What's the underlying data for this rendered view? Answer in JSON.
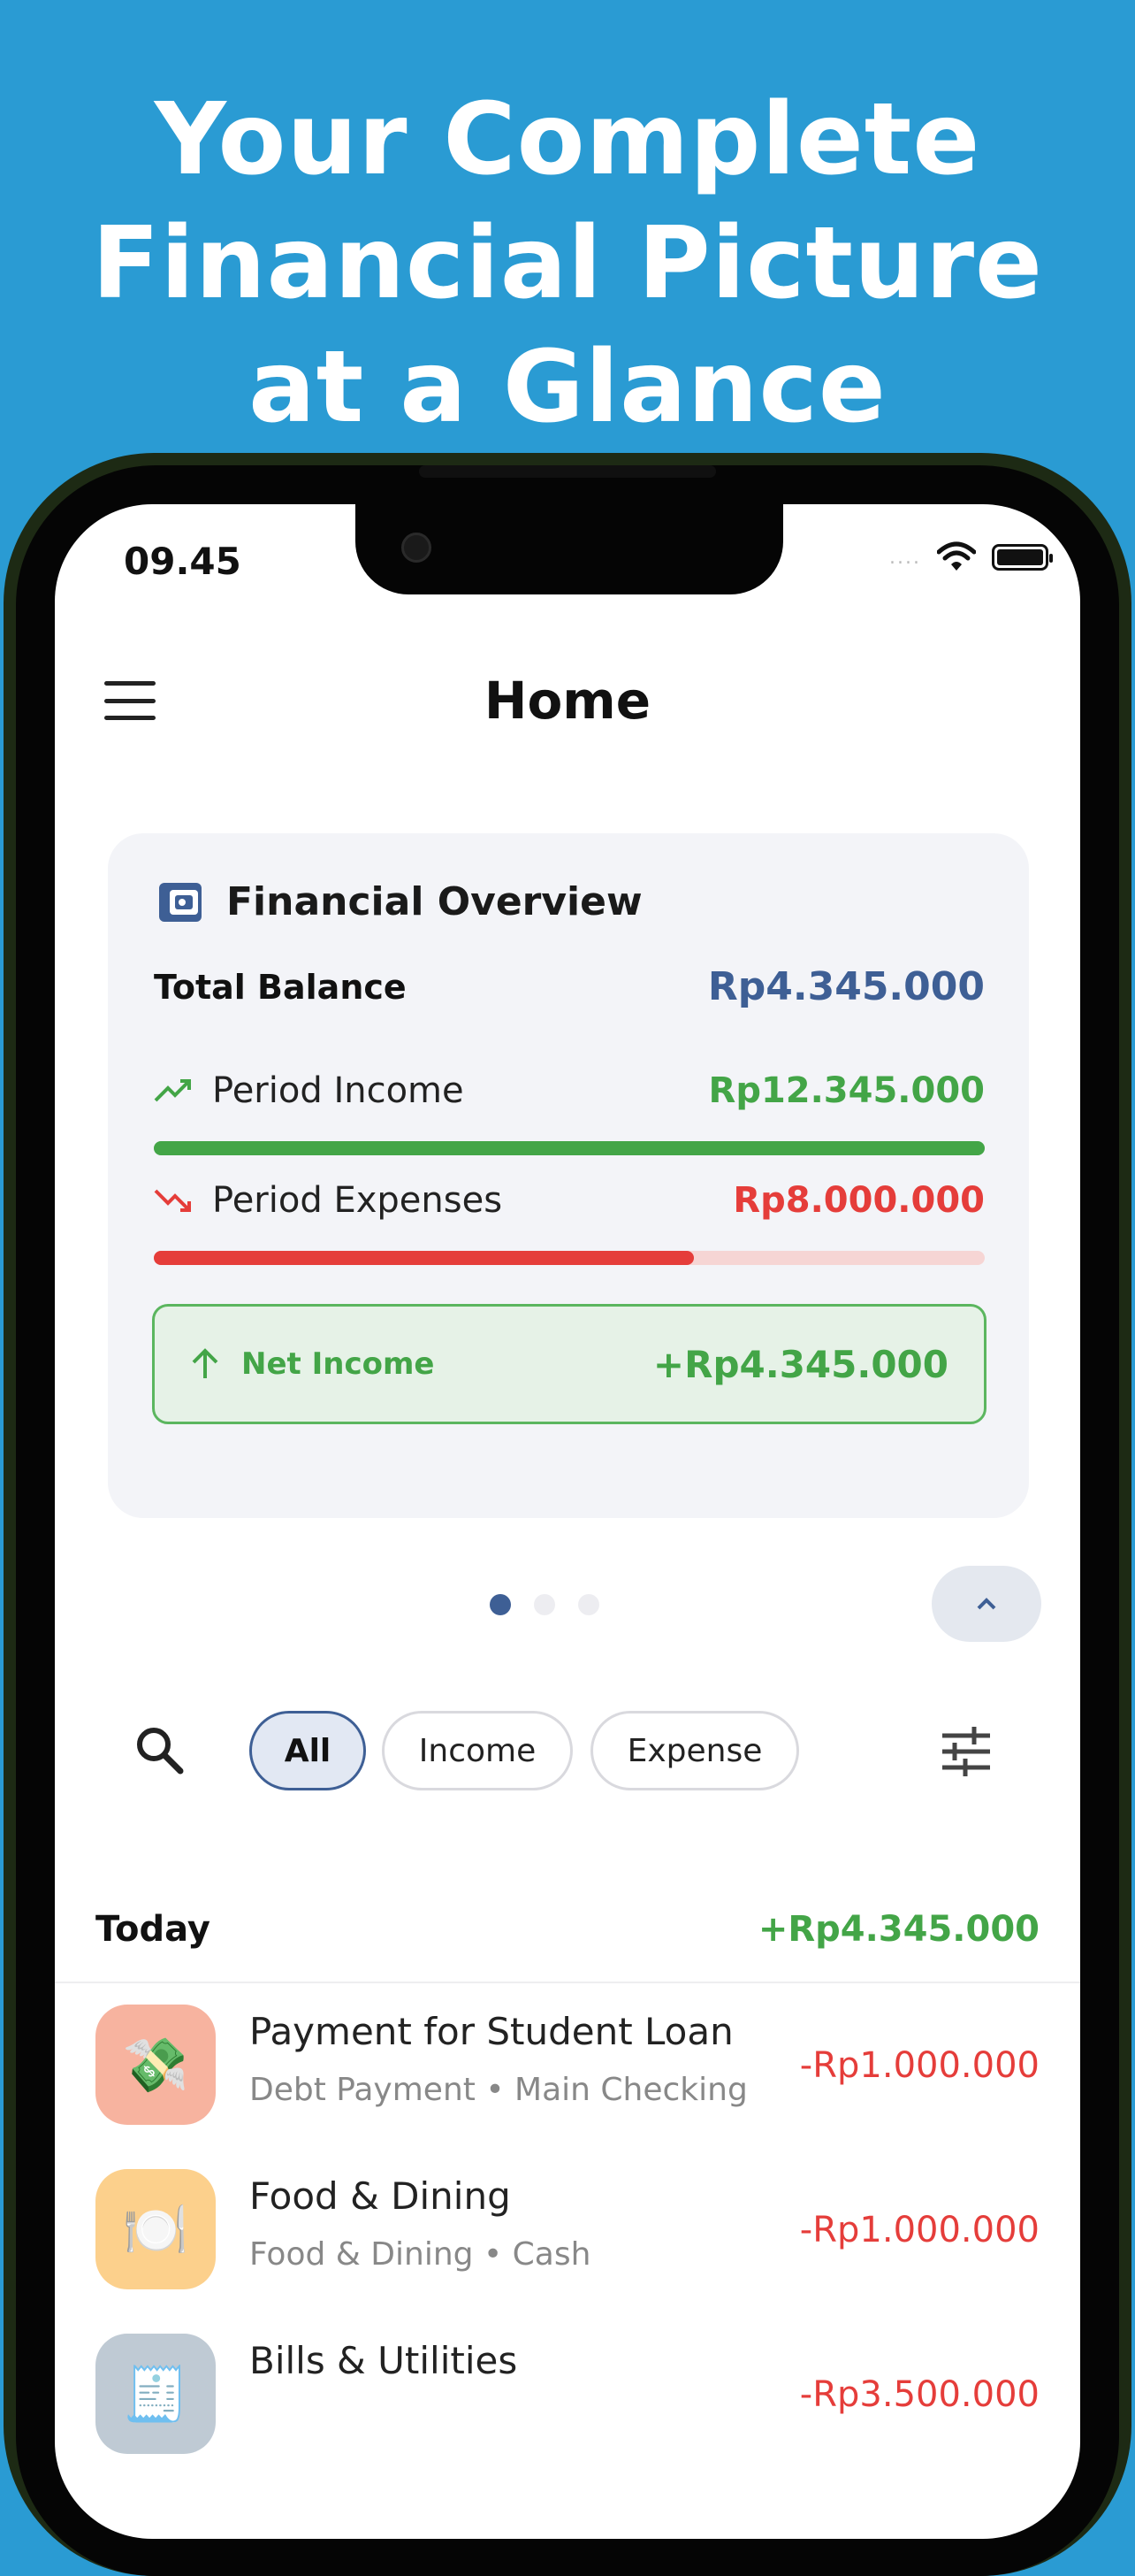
{
  "headline": {
    "line1": "Your Complete",
    "line2": "Financial Picture",
    "line3": "at a Glance"
  },
  "status_bar": {
    "time": "09.45",
    "signal": "....",
    "icons": [
      "wifi-icon",
      "battery-icon"
    ]
  },
  "header": {
    "title": "Home",
    "menu_icon": "hamburger-menu-icon"
  },
  "overview": {
    "title": "Financial Overview",
    "icon": "wallet-icon",
    "total_balance_label": "Total Balance",
    "total_balance_value": "Rp4.345.000",
    "income_label": "Period Income",
    "income_value": "Rp12.345.000",
    "income_fraction": 1.0,
    "expenses_label": "Period Expenses",
    "expenses_value": "Rp8.000.000",
    "expenses_fraction": 0.65,
    "net_label": "Net Income",
    "net_value": "+Rp4.345.000"
  },
  "pager": {
    "count": 3,
    "active": 0
  },
  "filters": {
    "chips": [
      {
        "label": "All",
        "active": true
      },
      {
        "label": "Income",
        "active": false
      },
      {
        "label": "Expense",
        "active": false
      }
    ]
  },
  "transactions": {
    "group_label": "Today",
    "group_total": "+Rp4.345.000",
    "items": [
      {
        "name": "Payment for Student Loan",
        "sub": "Debt Payment • Main Checking",
        "amount": "-Rp1.000.000",
        "icon": "money-bag-icon",
        "icon_glyph": "💸",
        "icon_bg": "#F7B39F"
      },
      {
        "name": "Food & Dining",
        "sub": "Food & Dining • Cash",
        "amount": "-Rp1.000.000",
        "icon": "plate-cutlery-icon",
        "icon_glyph": "🍽️",
        "icon_bg": "#FCD08C"
      },
      {
        "name": "Bills & Utilities",
        "sub": "",
        "amount": "-Rp3.500.000",
        "icon": "receipt-icon",
        "icon_glyph": "🧾",
        "icon_bg": "#BFCAD4"
      }
    ]
  },
  "colors": {
    "background": "#2A9BD3",
    "income": "#43A547",
    "expense": "#E53D3A",
    "accent": "#3E5F95"
  }
}
